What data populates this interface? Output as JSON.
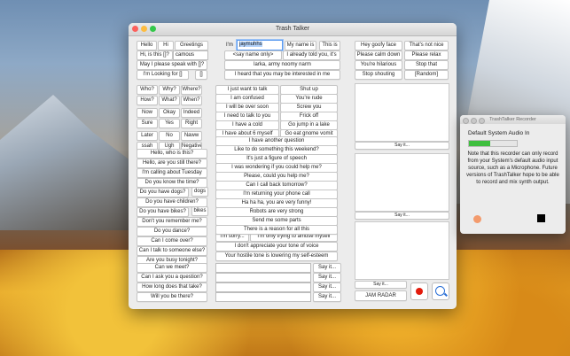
{
  "window": {
    "title": "Trash Talker"
  },
  "grid": {
    "hello": "Hello",
    "hi": "Hi",
    "greetings": "Greetings",
    "hi_is_this": "Hi, is this []?",
    "name_field": "camous",
    "may_i_speak": "May I please speak with []?",
    "im_looking": "I'm Looking for []",
    "bracket": "[]",
    "im_label": "I'm",
    "im_field": "jaymuhhs",
    "my_name_is": "My name is",
    "this_is": "This is",
    "say_name_only": "<say name only>",
    "already_told": "I already told you, it's",
    "larka": "larka, army noomy narm",
    "heard_interested": "I heard that you may be interested in me",
    "hey_goofy": "Hey goofy face",
    "thats_not_nice": "That's not nice",
    "please_calm": "Please calm down",
    "please_relax": "Please relax",
    "youre_hilarious": "You're hilarious",
    "stop_that": "Stop that",
    "stop_shouting": "Stop shouting",
    "random": "[Random]",
    "short_words": [
      "Who?",
      "Why?",
      "Where?",
      "How?",
      "What?",
      "When?",
      "Now",
      "Okay",
      "Indeed",
      "Sure",
      "Yes",
      "Right",
      "Later",
      "No",
      "Naww",
      "ssah",
      "Ugh",
      "Negative"
    ],
    "left_phrases": [
      "Hello, who is this?",
      "Hello, are you still there?",
      "I'm calling about Tuesday",
      "Do you know the time?",
      "Do you have dogs?",
      "Do you have children?",
      "Do you have bikes?",
      "Don't you remember me?",
      "Do you dance?",
      "Can I come over?",
      "Can I talk to someone else?",
      "Are you busy tonight?",
      "Can we meet?",
      "Can I ask you a question?",
      "How long does that take?",
      "Will you be there?"
    ],
    "dogs": "dogs",
    "bikes": "bikes",
    "mid_pairs": [
      [
        "I just want to talk",
        "Shut up"
      ],
      [
        "I am confused",
        "You're rude"
      ],
      [
        "I will be over soon",
        "Screw you"
      ],
      [
        "I need to talk to you",
        "Frick off"
      ],
      [
        "I have a cold",
        "Go jump in a lake"
      ],
      [
        "I have about 6 myself",
        "Go eat gnome vomit"
      ]
    ],
    "mid_single": [
      "I have another question",
      "Like to do something this weekend?",
      "It's just a figure of speech",
      "I was wondering if you could help me?",
      "Please, could you help me?",
      "Can I call back tomorrow?",
      "I'm returning your phone call",
      "Ha ha ha, you are very funny!",
      "Robots are very strong",
      "Send me some parts",
      "There is a reason for all this"
    ],
    "im_sorry": "I'm sorry...",
    "amuse": "I'm only trying to amuse myself",
    "dont_appreciate": "I don't appreciate your tone of voice",
    "hostile": "Your hostile tone is lowering my self-esteem",
    "say_it": "Say it...",
    "jam_radar": "JAM RADAR"
  },
  "panel": {
    "title": "TrashTalker Recorder",
    "source": "Default System Audio In",
    "level": 0.45,
    "note": "Note that this recorder can only record from your System's default audio input source, such as a Microphone. Future versions of TrashTalker hope to be able to record and mix synth output."
  }
}
